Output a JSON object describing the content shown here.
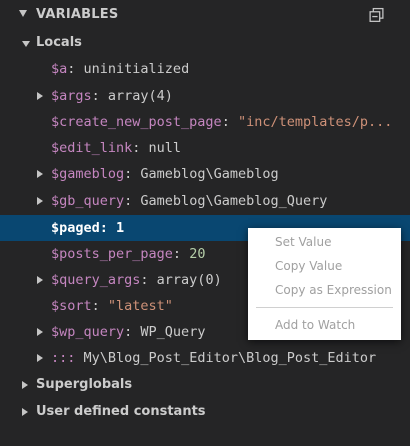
{
  "header": {
    "title": "VARIABLES",
    "collapse_icon": "collapse-all-icon"
  },
  "scopes": {
    "locals": "Locals",
    "superglobals": "Superglobals",
    "constants": "User defined constants"
  },
  "variables": [
    {
      "name": "$a",
      "value": "uninitialized",
      "expandable": false,
      "type": "plain"
    },
    {
      "name": "$args",
      "value": "array(4)",
      "expandable": true,
      "type": "plain"
    },
    {
      "name": "$create_new_post_page",
      "value": "\"inc/templates/p...",
      "expandable": false,
      "type": "str"
    },
    {
      "name": "$edit_link",
      "value": "null",
      "expandable": false,
      "type": "plain"
    },
    {
      "name": "$gameblog",
      "value": "Gameblog\\Gameblog",
      "expandable": true,
      "type": "plain"
    },
    {
      "name": "$gb_query",
      "value": "Gameblog\\Gameblog_Query",
      "expandable": true,
      "type": "plain"
    },
    {
      "name": "$paged",
      "value": "1",
      "expandable": false,
      "type": "num",
      "selected": true
    },
    {
      "name": "$posts_per_page",
      "value": "20",
      "expandable": false,
      "type": "num"
    },
    {
      "name": "$query_args",
      "value": "array(0)",
      "expandable": true,
      "type": "plain"
    },
    {
      "name": "$sort",
      "value": "\"latest\"",
      "expandable": false,
      "type": "str"
    },
    {
      "name": "$wp_query",
      "value": "WP_Query",
      "expandable": true,
      "type": "plain"
    },
    {
      "name": ":::",
      "value": "My\\Blog_Post_Editor\\Blog_Post_Editor",
      "expandable": true,
      "type": "plain"
    }
  ],
  "context_menu": {
    "set_value": "Set Value",
    "copy_value": "Copy Value",
    "copy_expression": "Copy as Expression",
    "add_to_watch": "Add to Watch"
  },
  "colors": {
    "background": "#252526",
    "selection": "#094771",
    "name": "#c586c0",
    "string": "#ce9178",
    "number": "#b5cea8",
    "text": "#cccccc"
  }
}
